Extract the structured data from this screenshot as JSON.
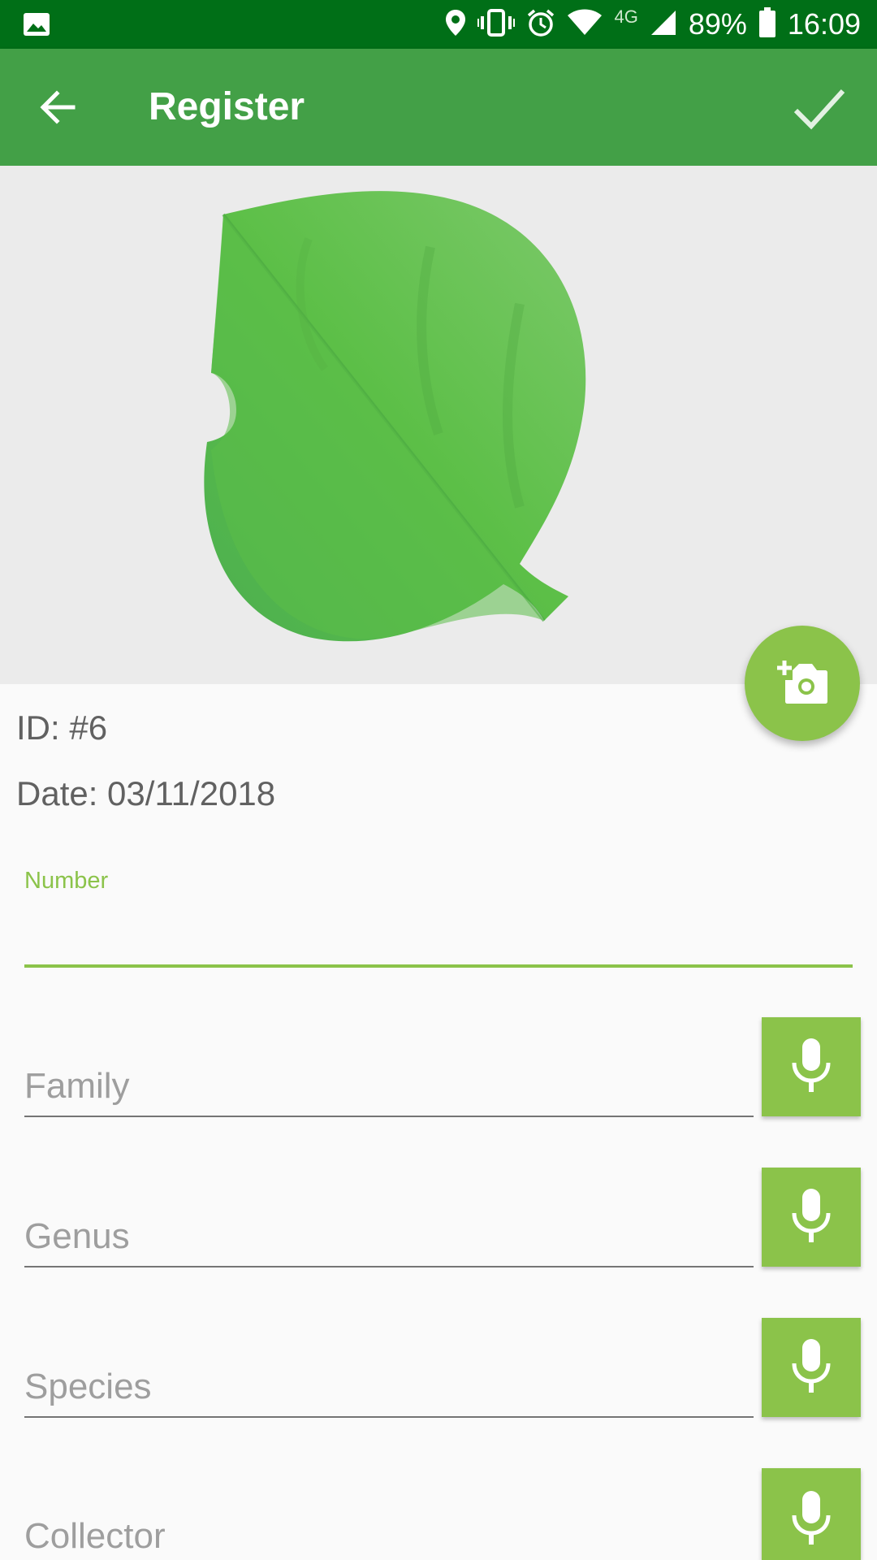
{
  "status_bar": {
    "network": "4G",
    "battery": "89%",
    "time": "16:09"
  },
  "app_bar": {
    "title": "Register"
  },
  "record": {
    "id_text": "ID: #6",
    "date_text": "Date: 03/11/2018"
  },
  "form": {
    "number_label": "Number",
    "number_value": "",
    "fields": [
      {
        "hint": "Family"
      },
      {
        "hint": "Genus"
      },
      {
        "hint": "Species"
      },
      {
        "hint": "Collector"
      }
    ]
  },
  "colors": {
    "status_bar": "#006f17",
    "app_bar": "#43a047",
    "accent": "#8bc34a"
  }
}
